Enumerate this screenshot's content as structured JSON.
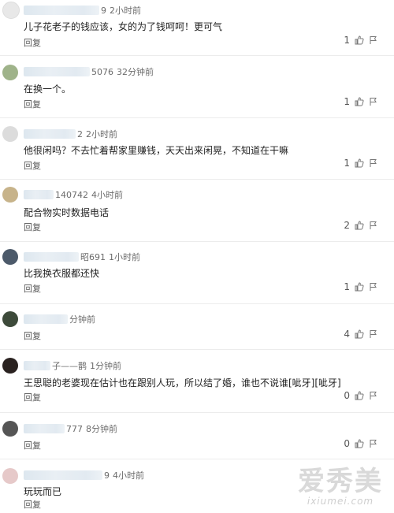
{
  "comments": [
    {
      "name_tail": "9",
      "time": "2小时前",
      "text": "儿子花老子的钱应该，女的为了钱呵呵！更可气",
      "likes": "1",
      "reply": "回复",
      "avatar_color": "#e8e8e8"
    },
    {
      "name_tail": "5076",
      "time": "32分钟前",
      "text": "在换一个。",
      "likes": "1",
      "reply": "回复",
      "avatar_color": "#9fb38a"
    },
    {
      "name_tail": "2",
      "time": "2小时前",
      "text": "他很闲吗？不去忙着帮家里赚钱，天天出来闲晃，不知道在干嘛",
      "likes": "1",
      "reply": "回复",
      "avatar_color": "#d8d8d8"
    },
    {
      "name_tail": "140742",
      "time": "4小时前",
      "text": "配合物实时数据电话",
      "likes": "2",
      "reply": "回复",
      "avatar_color": "#c7b38a"
    },
    {
      "name_tail": "昭691",
      "time": "1小时前",
      "text": "比我换衣服都还快",
      "likes": "1",
      "reply": "回复",
      "avatar_color": "#4c5a6a"
    },
    {
      "name_tail": "分钟前",
      "time": "",
      "text": "",
      "likes": "4",
      "reply": "回复",
      "avatar_color": "#3d4a3a"
    },
    {
      "name_tail": "子——鹊",
      "time": "1分钟前",
      "text": "王思聪的老婆现在估计也在跟别人玩，所以结了婚，谁也不说谁[呲牙][呲牙]",
      "likes": "0",
      "reply": "回复",
      "avatar_color": "#2a2220"
    },
    {
      "name_tail": "777",
      "time": "8分钟前",
      "text": "",
      "likes": "0",
      "reply": "回复",
      "avatar_color": "#555555"
    },
    {
      "name_tail": "9",
      "time": "4小时前",
      "text": "玩玩而已",
      "likes": "0",
      "reply": "回复",
      "avatar_color": "#e6c9c9"
    }
  ],
  "watermark": {
    "main": "爱秀美",
    "sub": "ixiumei.com"
  }
}
